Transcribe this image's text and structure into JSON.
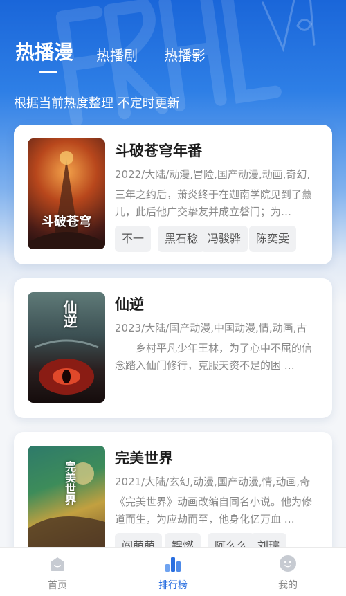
{
  "header": {
    "tabs": [
      {
        "label": "热播漫",
        "active": true
      },
      {
        "label": "热播剧",
        "active": false
      },
      {
        "label": "热播影",
        "active": false
      }
    ],
    "subtitle": "根据当前热度整理 不定时更新"
  },
  "items": [
    {
      "title": "斗破苍穹年番",
      "meta": "2022/大陆/动漫,冒险,国产动漫,动画,奇幻,",
      "desc": "三年之约后，萧炎终于在迦南学院见到了薰儿，此后他广交挚友并成立磐门；为…",
      "cover_text": "斗破苍穹",
      "tags": [
        "不一",
        "黑石稔",
        "冯骏骅",
        "陈奕雯"
      ]
    },
    {
      "title": "仙逆",
      "meta": "2023/大陆/国产动漫,中国动漫,情,动画,古",
      "desc": "　　乡村平凡少年王林，为了心中不屈的信念踏入仙门修行，克服天资不足的困 …",
      "cover_text": "仙逆",
      "tags": []
    },
    {
      "title": "完美世界",
      "meta": "2021/大陆/玄幻,动漫,国产动漫,情,动画,奇",
      "desc": "《完美世界》动画改编自同名小说。他为修道而生，为应劫而至，他身化亿万血 …",
      "cover_text": "完美世界",
      "tags": [
        "阎萌萌",
        "锦燃",
        "阿么么",
        "刘琮"
      ]
    }
  ],
  "bottom_nav": [
    {
      "label": "首页",
      "icon": "home-icon",
      "active": false
    },
    {
      "label": "排行榜",
      "icon": "bar-chart-icon",
      "active": true
    },
    {
      "label": "我的",
      "icon": "profile-icon",
      "active": false
    }
  ],
  "colors": {
    "accent": "#2a6fe0",
    "header_blue": "#1a66d9",
    "muted_text": "#8a8a8a"
  }
}
